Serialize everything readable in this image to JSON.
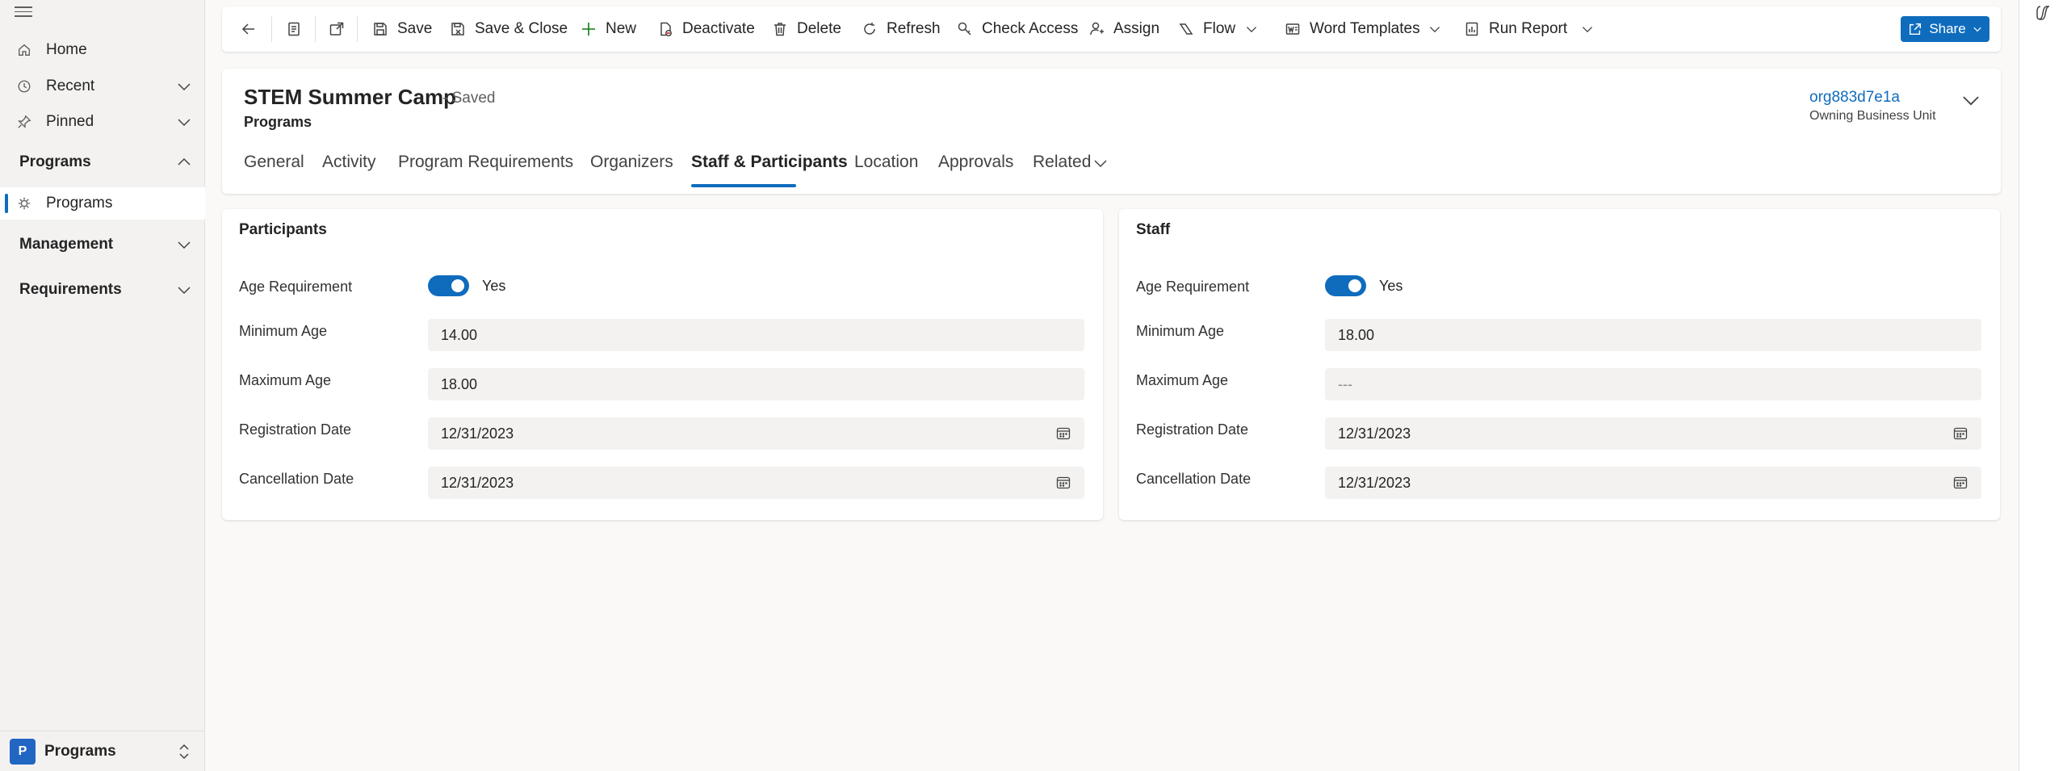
{
  "sidebar": {
    "items": [
      {
        "label": "Home",
        "icon": "home-icon"
      },
      {
        "label": "Recent",
        "icon": "clock-icon"
      },
      {
        "label": "Pinned",
        "icon": "pin-icon"
      }
    ],
    "groups": [
      {
        "label": "Programs",
        "expanded": true,
        "children": [
          {
            "label": "Programs",
            "icon": "program-icon",
            "selected": true
          }
        ]
      },
      {
        "label": "Management",
        "expanded": false
      },
      {
        "label": "Requirements",
        "expanded": false
      }
    ],
    "area": {
      "badge": "P",
      "label": "Programs"
    }
  },
  "commandbar": {
    "save": "Save",
    "save_close": "Save & Close",
    "new": "New",
    "deactivate": "Deactivate",
    "delete": "Delete",
    "refresh": "Refresh",
    "check_access": "Check Access",
    "assign": "Assign",
    "flow": "Flow",
    "word_templates": "Word Templates",
    "run_report": "Run Report",
    "share": "Share"
  },
  "header": {
    "title": "STEM Summer Camp",
    "status": "- Saved",
    "entity": "Programs",
    "owner": {
      "value": "org883d7e1a",
      "label": "Owning Business Unit"
    },
    "tabs": [
      "General",
      "Activity",
      "Program Requirements",
      "Organizers",
      "Staff & Participants",
      "Location",
      "Approvals",
      "Related"
    ],
    "active_tab": "Staff & Participants"
  },
  "participants": {
    "title": "Participants",
    "age_requirement": {
      "label": "Age Requirement",
      "value": "Yes",
      "on": true
    },
    "minimum_age": {
      "label": "Minimum Age",
      "value": "14.00"
    },
    "maximum_age": {
      "label": "Maximum Age",
      "value": "18.00"
    },
    "registration_date": {
      "label": "Registration Date",
      "value": "12/31/2023"
    },
    "cancellation_date": {
      "label": "Cancellation Date",
      "value": "12/31/2023"
    }
  },
  "staff": {
    "title": "Staff",
    "age_requirement": {
      "label": "Age Requirement",
      "value": "Yes",
      "on": true
    },
    "minimum_age": {
      "label": "Minimum Age",
      "value": "18.00"
    },
    "maximum_age": {
      "label": "Maximum Age",
      "value": "---"
    },
    "registration_date": {
      "label": "Registration Date",
      "value": "12/31/2023"
    },
    "cancellation_date": {
      "label": "Cancellation Date",
      "value": "12/31/2023"
    }
  },
  "colors": {
    "accent": "#0f6cbd",
    "background": "#faf9f8",
    "sidebar": "#f3f2f1"
  }
}
